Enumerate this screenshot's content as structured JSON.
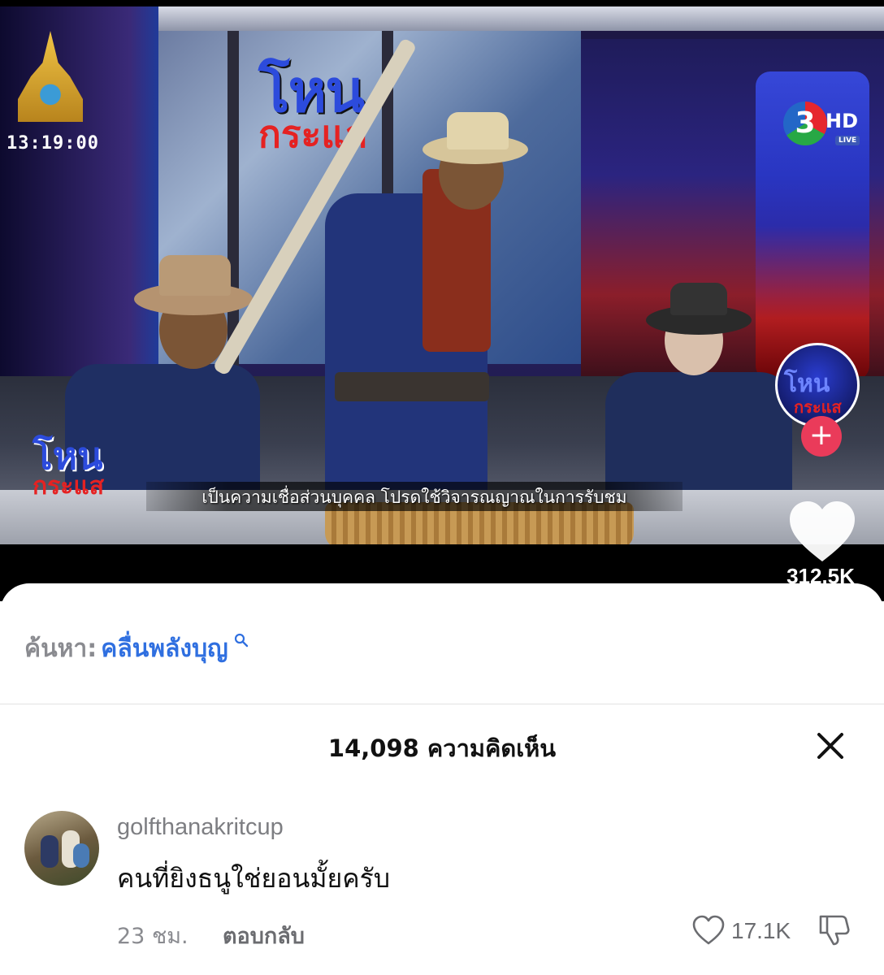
{
  "video": {
    "clock": "13:19:00",
    "channel_number": "3",
    "channel_hd": "HD",
    "channel_live": "LIVE",
    "show_logo_line1": "โหน",
    "show_logo_line2": "กระแส",
    "subtitle": "เป็นความเชื่อส่วนบุคคล โปรดใช้วิจารณญาณในการรับชม"
  },
  "rail": {
    "avatar_line1": "โหน",
    "avatar_line2": "กระแส",
    "follow_symbol": "+",
    "like_count": "312.5K"
  },
  "search": {
    "prefix": "ค้นหา:",
    "term": "คลื่นพลังบุญ"
  },
  "comments": {
    "title": "14,098 ความคิดเห็น",
    "items": [
      {
        "username": "golfthanakritcup",
        "text": "คนที่ยิงธนูใช่ยอนมั้ยครับ",
        "time": "23 ชม.",
        "reply_label": "ตอบกลับ",
        "likes": "17.1K"
      }
    ]
  },
  "icons": {
    "search": "search-icon",
    "close": "close-icon",
    "heart": "heart-icon",
    "dislike": "thumbs-down-icon",
    "follow": "plus-icon"
  },
  "colors": {
    "accent_blue": "#2f6fe0",
    "follow_red": "#ea3b5a",
    "muted_text": "#8a8b90"
  }
}
